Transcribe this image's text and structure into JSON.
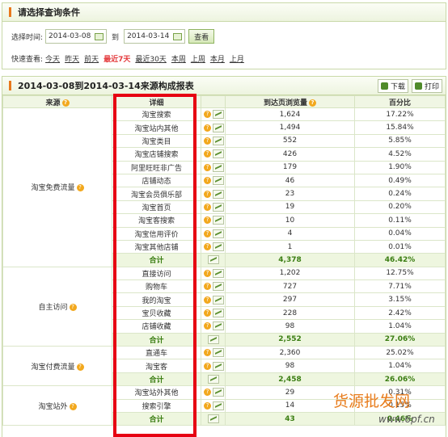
{
  "query": {
    "title": "请选择查询条件",
    "time_label": "选择时间:",
    "start_date": "2014-03-08",
    "to_label": "到",
    "end_date": "2014-03-14",
    "view_button": "查看",
    "quick_label": "快速查看:",
    "quick_links": [
      "今天",
      "昨天",
      "前天",
      "最近7天",
      "最近30天",
      "本周",
      "上周",
      "本月",
      "上月"
    ],
    "active_quick": "最近7天"
  },
  "report": {
    "title": "2014-03-08到2014-03-14来源构成报表",
    "download": "下载",
    "print": "打印",
    "headers": {
      "source": "来源",
      "detail": "详细",
      "visits": "到达页浏览量",
      "percent": "百分比"
    },
    "groups": [
      {
        "source": "淘宝免费流量",
        "rows": [
          {
            "detail": "淘宝搜索",
            "visits": "1,624",
            "percent": "17.22%"
          },
          {
            "detail": "淘宝站内其他",
            "visits": "1,494",
            "percent": "15.84%"
          },
          {
            "detail": "淘宝类目",
            "visits": "552",
            "percent": "5.85%"
          },
          {
            "detail": "淘宝店铺搜索",
            "visits": "426",
            "percent": "4.52%"
          },
          {
            "detail": "阿里旺旺非广告",
            "visits": "179",
            "percent": "1.90%"
          },
          {
            "detail": "店铺动态",
            "visits": "46",
            "percent": "0.49%"
          },
          {
            "detail": "淘宝会员俱乐部",
            "visits": "23",
            "percent": "0.24%"
          },
          {
            "detail": "淘宝首页",
            "visits": "19",
            "percent": "0.20%"
          },
          {
            "detail": "淘宝客搜索",
            "visits": "10",
            "percent": "0.11%"
          },
          {
            "detail": "淘宝信用评价",
            "visits": "4",
            "percent": "0.04%"
          },
          {
            "detail": "淘宝其他店铺",
            "visits": "1",
            "percent": "0.01%"
          }
        ],
        "total": {
          "label": "合计",
          "visits": "4,378",
          "percent": "46.42%"
        }
      },
      {
        "source": "自主访问",
        "rows": [
          {
            "detail": "直接访问",
            "visits": "1,202",
            "percent": "12.75%"
          },
          {
            "detail": "购物车",
            "visits": "727",
            "percent": "7.71%"
          },
          {
            "detail": "我的淘宝",
            "visits": "297",
            "percent": "3.15%"
          },
          {
            "detail": "宝贝收藏",
            "visits": "228",
            "percent": "2.42%"
          },
          {
            "detail": "店铺收藏",
            "visits": "98",
            "percent": "1.04%"
          }
        ],
        "total": {
          "label": "合计",
          "visits": "2,552",
          "percent": "27.06%"
        }
      },
      {
        "source": "淘宝付费流量",
        "rows": [
          {
            "detail": "直通车",
            "visits": "2,360",
            "percent": "25.02%"
          },
          {
            "detail": "淘宝客",
            "visits": "98",
            "percent": "1.04%"
          }
        ],
        "total": {
          "label": "合计",
          "visits": "2,458",
          "percent": "26.06%"
        }
      },
      {
        "source": "淘宝站外",
        "rows": [
          {
            "detail": "淘宝站外其他",
            "visits": "29",
            "percent": "0.31%"
          },
          {
            "detail": "搜索引擎",
            "visits": "14",
            "percent": "0.15%"
          }
        ],
        "total": {
          "label": "合计",
          "visits": "43",
          "percent": "0.46%"
        }
      }
    ]
  },
  "watermark": {
    "text": "货源批发网",
    "url": "www.6pf.cn"
  }
}
